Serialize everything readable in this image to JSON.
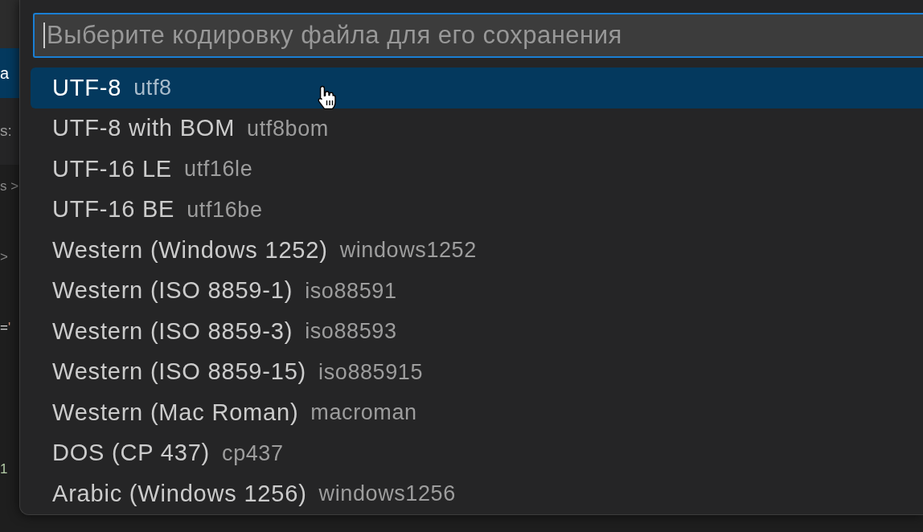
{
  "editor": {
    "tab": {
      "label": "а",
      "selected": true
    },
    "breadcrumb": "s:",
    "code_fragments": [
      {
        "tokens": [
          {
            "text": "s >",
            "kind": "punctuation"
          }
        ]
      },
      {
        "tokens": [
          {
            "text": ">",
            "kind": "punctuation"
          }
        ]
      },
      {
        "tokens": [
          {
            "text": "=",
            "kind": "operator"
          },
          {
            "text": "'",
            "kind": "string"
          }
        ]
      },
      {
        "tokens": [
          {
            "text": "1",
            "kind": "number"
          }
        ]
      }
    ]
  },
  "quick_pick": {
    "input": {
      "placeholder": "Выберите кодировку файла для его сохранения"
    },
    "items": [
      {
        "label": "UTF-8",
        "description": "utf8",
        "selected": true
      },
      {
        "label": "UTF-8 with BOM",
        "description": "utf8bom",
        "selected": false
      },
      {
        "label": "UTF-16 LE",
        "description": "utf16le",
        "selected": false
      },
      {
        "label": "UTF-16 BE",
        "description": "utf16be",
        "selected": false
      },
      {
        "label": "Western (Windows 1252)",
        "description": "windows1252",
        "selected": false
      },
      {
        "label": "Western (ISO 8859-1)",
        "description": "iso88591",
        "selected": false
      },
      {
        "label": "Western (ISO 8859-3)",
        "description": "iso88593",
        "selected": false
      },
      {
        "label": "Western (ISO 8859-15)",
        "description": "iso885915",
        "selected": false
      },
      {
        "label": "Western (Mac Roman)",
        "description": "macroman",
        "selected": false
      },
      {
        "label": "DOS (CP 437)",
        "description": "cp437",
        "selected": false
      },
      {
        "label": "Arabic (Windows 1256)",
        "description": "windows1256",
        "selected": false
      }
    ]
  }
}
